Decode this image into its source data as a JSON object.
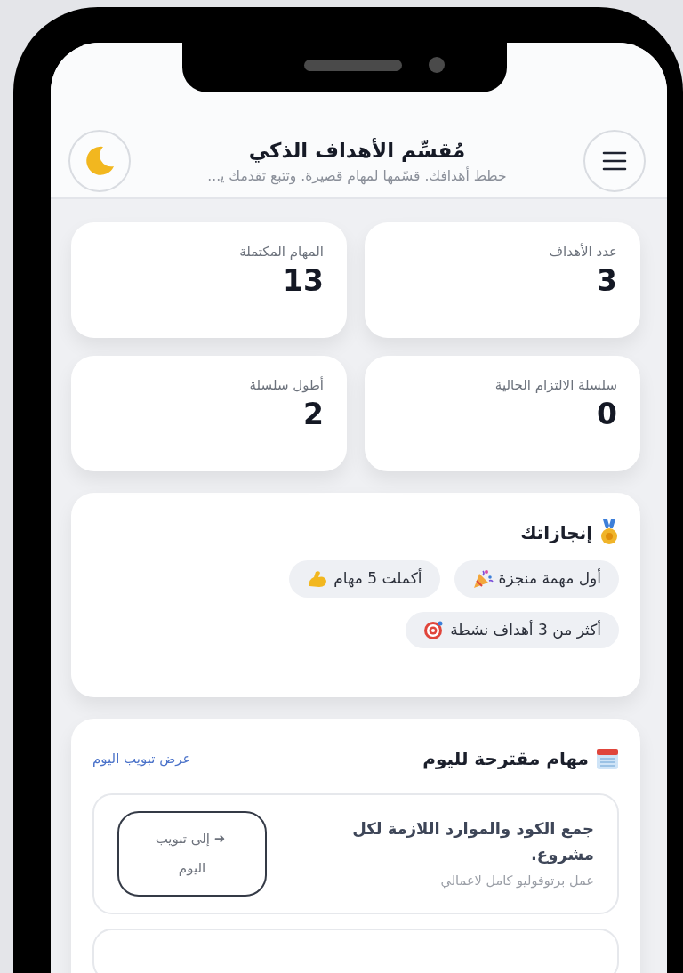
{
  "header": {
    "title": "مُقسِّم الأهداف الذكي",
    "subtitle": "خطط أهدافك. قسّمها لمهام قصيرة. وتتبع تقدمك ﻳ..."
  },
  "stats": [
    {
      "label": "عدد الأهداف",
      "value": "3"
    },
    {
      "label": "المهام المكتملة",
      "value": "13"
    },
    {
      "label": "سلسلة الالتزام الحالية",
      "value": "0"
    },
    {
      "label": "أطول سلسلة",
      "value": "2"
    }
  ],
  "achievements": {
    "title": "إنجازاتك",
    "badges": [
      {
        "label": "أول مهمة منجزة",
        "kind": "party"
      },
      {
        "label": "أكملت 5 مهام",
        "kind": "muscle"
      },
      {
        "label": "أكثر من 3 أهداف نشطة",
        "kind": "target"
      }
    ]
  },
  "today": {
    "title": "مهام مقترحة لليوم",
    "link": "عرض تبويب اليوم",
    "tasks": [
      {
        "title": "جمع الكود والموارد اللازمة لكل مشروع.",
        "goal": "عمل برتوفوليو كامل لاعمالي",
        "button_icon": "➜",
        "button": "إلى تبويب اليوم"
      }
    ]
  }
}
